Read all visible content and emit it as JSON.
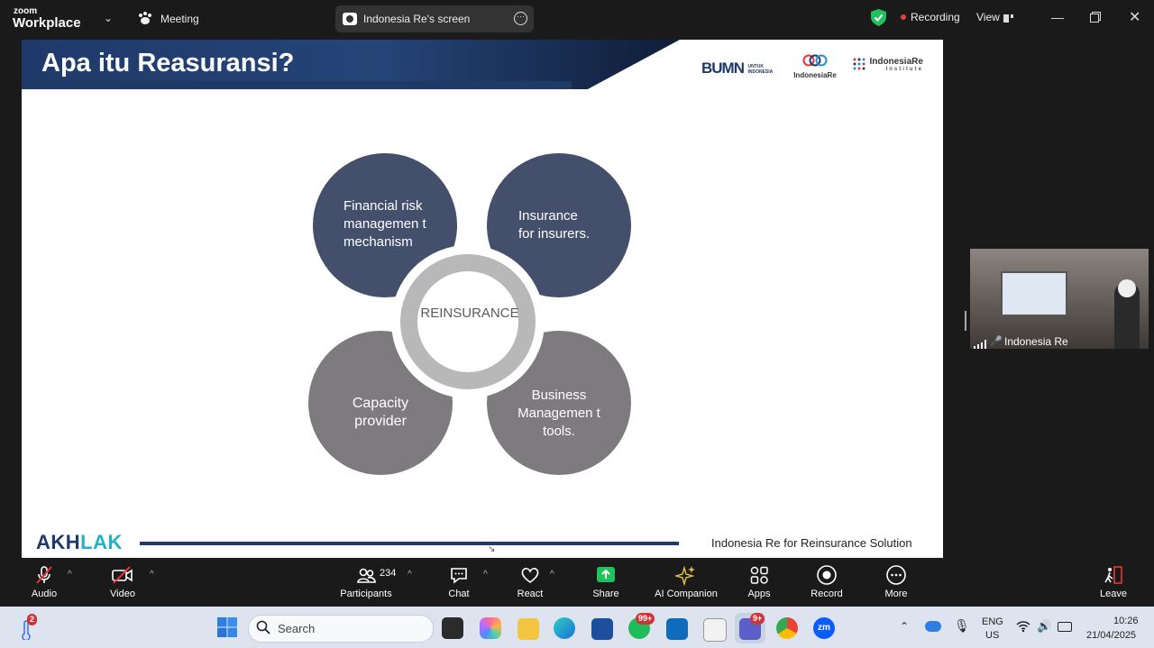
{
  "app": {
    "brand_top": "zoom",
    "brand_bottom": "Workplace",
    "meeting_label": "Meeting",
    "screen_share_label": "Indonesia Re's screen",
    "recording_label": "Recording",
    "view_label": "View"
  },
  "slide": {
    "title": "Apa itu Reasuransi?",
    "brand_bumn": "BUMN",
    "brand_bumn_sub": "UNTUK INDONESIA",
    "brand_indonesiare": "IndonesiaRe",
    "brand_institute": "IndonesiaRe",
    "brand_institute_sub": "Institute",
    "center": "REINSURANCE",
    "petals": [
      "Financial risk managemen t mechanism",
      "Insurance for insurers.",
      "Capacity provider",
      "Business Managemen t tools."
    ],
    "footer_logo": "AKHLAK",
    "footer_tagline": "Indonesia Re for Reinsurance Solution"
  },
  "participant_video": {
    "name": "Indonesia Re"
  },
  "toolbar": {
    "audio": "Audio",
    "video": "Video",
    "participants": "Participants",
    "participants_count": "234",
    "chat": "Chat",
    "react": "React",
    "share": "Share",
    "ai_companion": "AI Companion",
    "apps": "Apps",
    "record": "Record",
    "more": "More",
    "leave": "Leave"
  },
  "taskbar": {
    "search_placeholder": "Search",
    "notif_count": "2",
    "whatsapp_badge": "99+",
    "teams_badge": "9+",
    "language_top": "ENG",
    "language_bottom": "US",
    "time": "10:26",
    "date": "21/04/2025"
  },
  "colors": {
    "slide_band": "#1f3a6a",
    "petal_dark": "#44506b",
    "petal_grey": "#7d7b7d",
    "share_green": "#21c25e",
    "akhlak_blue": "#1f3a6a",
    "akhlak_teal": "#1fb3c8"
  }
}
